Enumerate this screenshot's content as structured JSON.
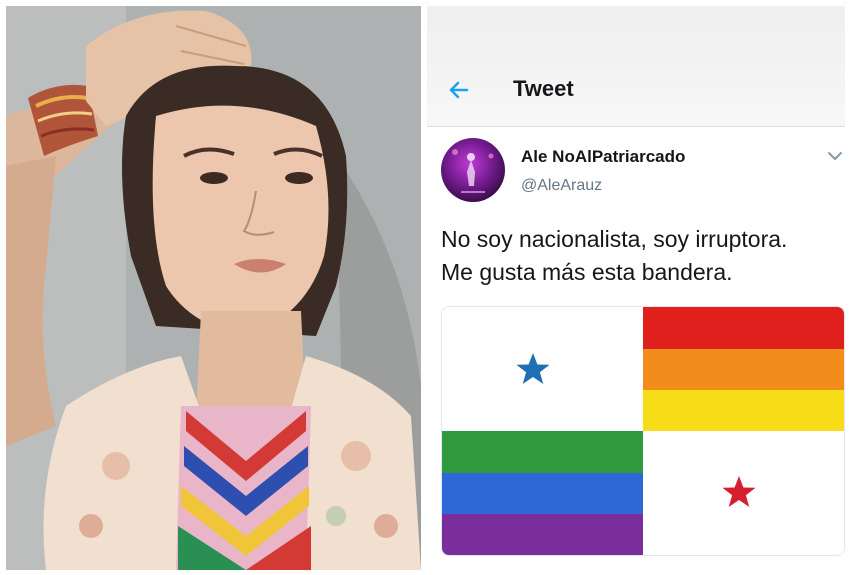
{
  "header": {
    "title": "Tweet"
  },
  "tweet": {
    "display_name": "Ale NoAlPatriarcado",
    "handle": "@AleArauz",
    "text_lines": [
      "No soy nacionalista, soy irruptora.",
      "Me gusta más esta bandera."
    ]
  },
  "icons": {
    "back": "back-arrow-icon",
    "menu": "chevron-down-icon"
  },
  "colors": {
    "accent": "#1da1f2",
    "flag_blue_star": "#1f6fb5",
    "flag_red_star": "#d61f2e",
    "rainbow": [
      "#e0201c",
      "#f28c1a",
      "#f7dc18",
      "#2f9b3e",
      "#2e68d6",
      "#7a2e9c"
    ]
  }
}
